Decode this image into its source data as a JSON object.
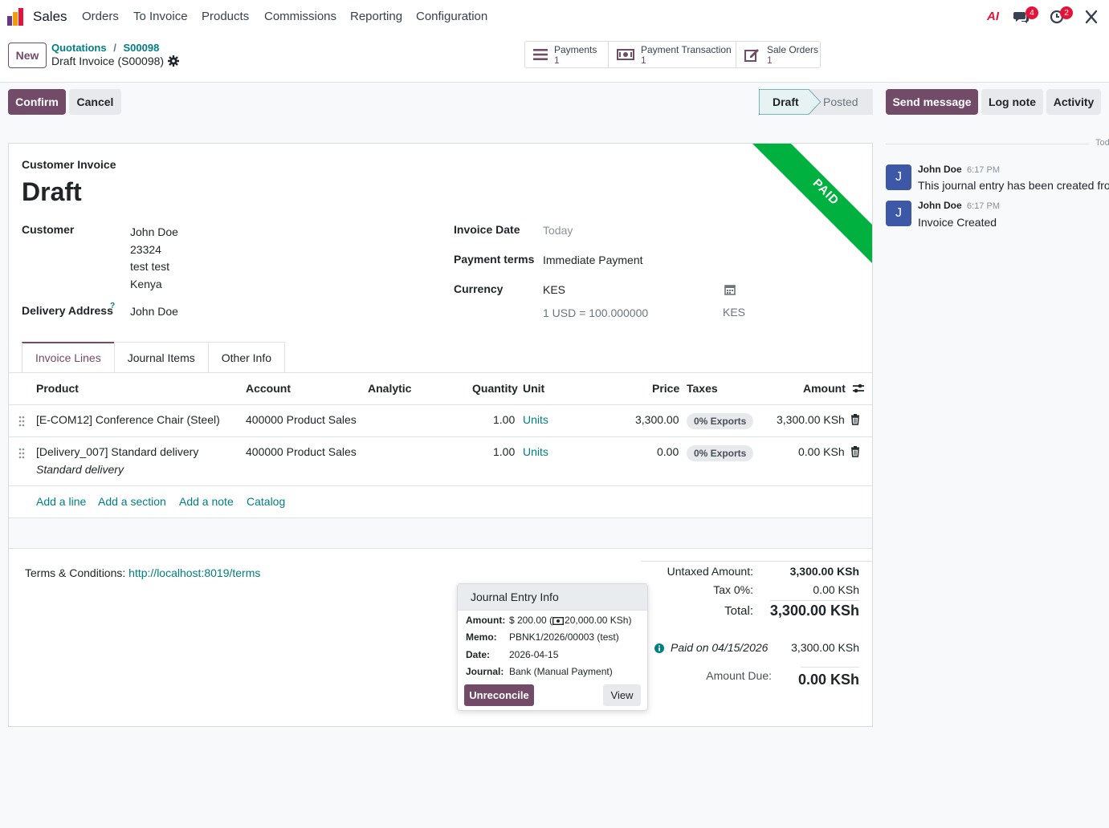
{
  "navbar": {
    "app_name": "Sales",
    "menu": [
      "Orders",
      "To Invoice",
      "Products",
      "Commissions",
      "Reporting",
      "Configuration"
    ],
    "ai_label": "AI",
    "messages_count": "4",
    "activities_count": "2"
  },
  "control": {
    "new_label": "New",
    "breadcrumb": {
      "parent": "Quotations",
      "separator": "/",
      "order": "S00098"
    },
    "record_title": "Draft Invoice (S00098)",
    "smart_buttons": [
      {
        "label": "Payments",
        "count": "1",
        "icon": "list-icon"
      },
      {
        "label": "Payment Transaction",
        "count": "1",
        "icon": "money-icon"
      },
      {
        "label": "Sale Orders",
        "count": "1",
        "icon": "edit-icon"
      }
    ]
  },
  "actions": {
    "confirm": "Confirm",
    "cancel": "Cancel",
    "status": [
      "Draft",
      "Posted"
    ],
    "active_status": "Draft"
  },
  "chatter": {
    "send_message": "Send message",
    "log_note": "Log note",
    "activity": "Activity",
    "divider": "Today",
    "messages": [
      {
        "avatar": "J",
        "author": "John Doe",
        "time": "6:17 PM",
        "body": "This journal entry has been created from"
      },
      {
        "avatar": "J",
        "author": "John Doe",
        "time": "6:17 PM",
        "body": "Invoice Created"
      }
    ]
  },
  "invoice": {
    "type": "Customer Invoice",
    "state": "Draft",
    "ribbon": "PAID",
    "customer_label": "Customer",
    "customer": [
      "John Doe",
      "23324",
      "test test",
      "Kenya"
    ],
    "delivery_label": "Delivery Address",
    "delivery_help": "?",
    "delivery": "John Doe",
    "invoice_date_label": "Invoice Date",
    "invoice_date_placeholder": "Today",
    "payment_terms_label": "Payment terms",
    "payment_terms": "Immediate Payment",
    "currency_label": "Currency",
    "currency": "KES",
    "rate": "1 USD = 100.000000",
    "rate_currency": "KES"
  },
  "tabs": [
    "Invoice Lines",
    "Journal Items",
    "Other Info"
  ],
  "lines": {
    "headers": {
      "product": "Product",
      "account": "Account",
      "analytic": "Analytic",
      "quantity": "Quantity",
      "unit": "Unit",
      "price": "Price",
      "taxes": "Taxes",
      "amount": "Amount"
    },
    "rows": [
      {
        "product": "[E-COM12] Conference Chair (Steel)",
        "description": "",
        "account": "400000 Product Sales",
        "quantity": "1.00",
        "unit": "Units",
        "price": "3,300.00",
        "tax": "0% Exports",
        "amount": "3,300.00 KSh"
      },
      {
        "product": "[Delivery_007] Standard delivery",
        "description": "Standard delivery",
        "account": "400000 Product Sales",
        "quantity": "1.00",
        "unit": "Units",
        "price": "0.00",
        "tax": "0% Exports",
        "amount": "0.00 KSh"
      }
    ],
    "add_links": [
      "Add a line",
      "Add a section",
      "Add a note",
      "Catalog"
    ]
  },
  "terms": {
    "label": "Terms & Conditions:",
    "link": "http://localhost:8019/terms"
  },
  "totals": {
    "untaxed_label": "Untaxed Amount:",
    "untaxed": "3,300.00 KSh",
    "tax_label": "Tax 0%:",
    "tax": "0.00 KSh",
    "total_label": "Total:",
    "total": "3,300.00 KSh",
    "paid_label": "Paid on 04/15/2026",
    "paid": "3,300.00 KSh",
    "due_label": "Amount Due:",
    "due": "0.00 KSh"
  },
  "popover": {
    "title": "Journal Entry Info",
    "amount_label": "Amount:",
    "amount_prefix": "$ 200.00 (",
    "amount_suffix": "20,000.00 KSh)",
    "memo_label": "Memo:",
    "memo": "PBNK1/2026/00003 (test)",
    "date_label": "Date:",
    "date": "2026-04-15",
    "journal_label": "Journal:",
    "journal": "Bank (Manual Payment)",
    "unreconcile": "Unreconcile",
    "view": "View"
  },
  "colors": {
    "brand": "#714B67",
    "link": "#017e84",
    "ribbon": "#00b140",
    "badge_red": "#e5133a"
  }
}
